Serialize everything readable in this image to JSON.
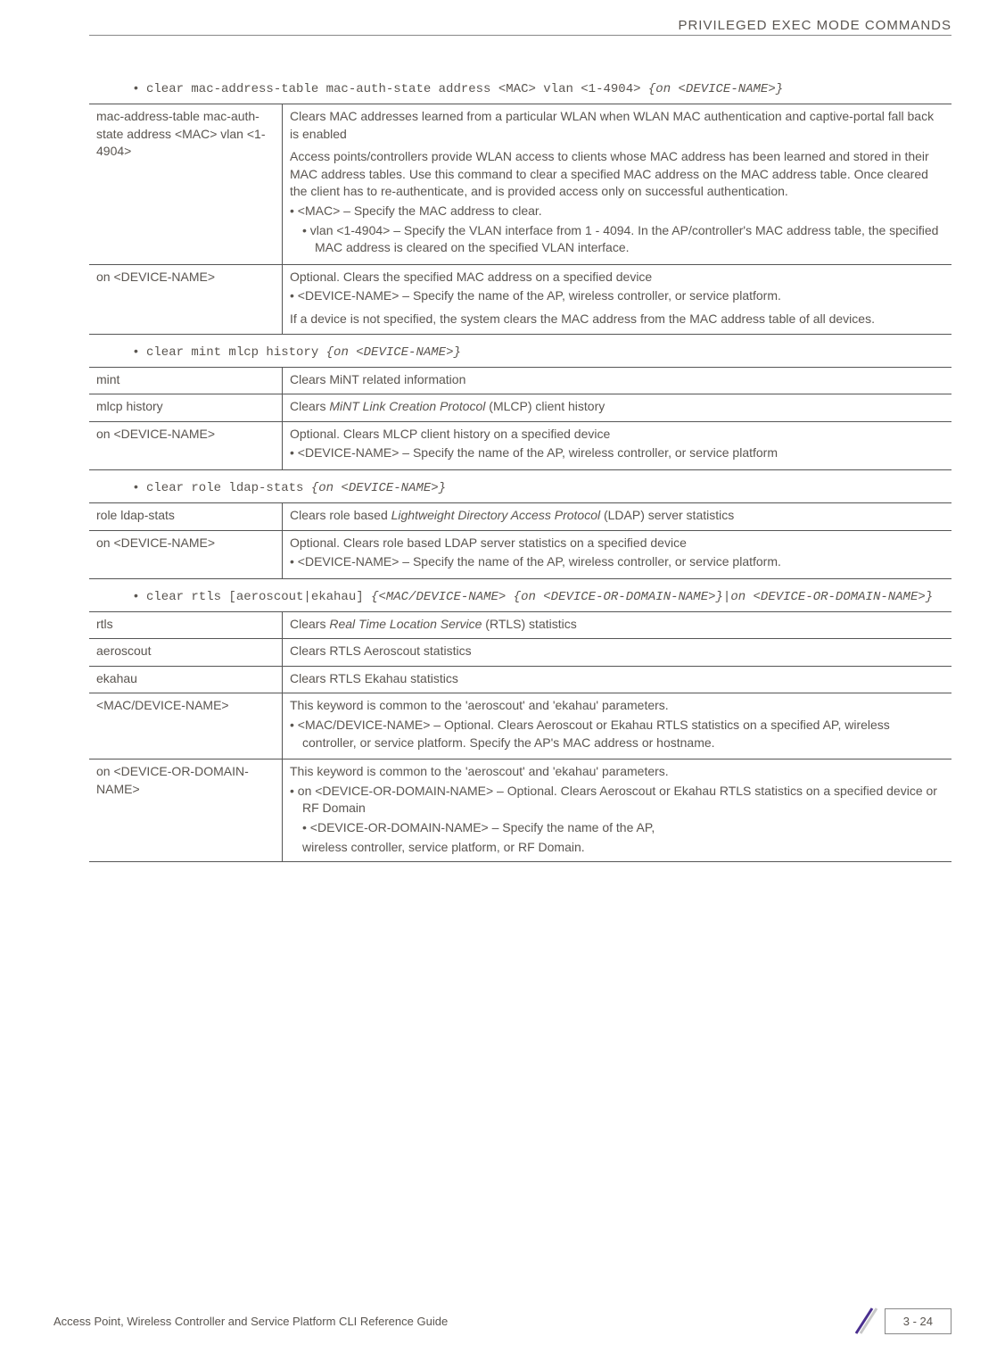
{
  "header": {
    "title": "PRIVILEGED EXEC MODE COMMANDS"
  },
  "syntax1": {
    "cmd": "clear mac-address-table mac-auth-state address <MAC> vlan <1-4904> ",
    "opt": "{on <DEVICE-NAME>}"
  },
  "table1": {
    "r1c1": "mac-address-table mac-auth-state address <MAC> vlan <1-4904>",
    "r1p1": "Clears MAC addresses learned from a particular WLAN when WLAN MAC authentication and captive-portal fall back is enabled",
    "r1p2": "Access points/controllers provide WLAN access to clients whose MAC address has been learned and stored in their MAC address tables. Use this command to clear a specified MAC address on the MAC address table. Once cleared the client has to re-authenticate, and is provided access only on successful authentication.",
    "r1b1": "<MAC> – Specify the MAC address to clear.",
    "r1b2": "vlan <1-4904> – Specify the VLAN interface from 1 - 4094. In the AP/controller's MAC address table, the specified MAC address is cleared on the specified VLAN interface.",
    "r2c1": "on <DEVICE-NAME>",
    "r2p1": "Optional. Clears the specified MAC address on a specified device",
    "r2b1": "<DEVICE-NAME> – Specify the name of the AP, wireless controller, or service platform.",
    "r2p2": "If a device is not specified, the system clears the MAC address from the MAC address table of all devices."
  },
  "syntax2": {
    "cmd": "clear mint mlcp history ",
    "opt": "{on <DEVICE-NAME>}"
  },
  "table2": {
    "r1c1": "mint",
    "r1c2": "Clears MiNT related information",
    "r2c1": "mlcp history",
    "r2c2a": "Clears ",
    "r2c2i": "MiNT Link Creation Protocol",
    "r2c2b": " (MLCP) client history",
    "r3c1": "on <DEVICE-NAME>",
    "r3p1": "Optional. Clears MLCP client history on a specified device",
    "r3b1": "<DEVICE-NAME> – Specify the name of the AP, wireless controller, or service platform"
  },
  "syntax3": {
    "cmd": "clear role ldap-stats ",
    "opt": "{on <DEVICE-NAME>}"
  },
  "table3": {
    "r1c1": "role ldap-stats",
    "r1c2a": "Clears role based ",
    "r1c2i": "Lightweight Directory Access Protocol",
    "r1c2b": " (LDAP) server statistics",
    "r2c1": "on <DEVICE-NAME>",
    "r2p1": "Optional. Clears role based LDAP server statistics on a specified device",
    "r2b1": "<DEVICE-NAME> – Specify the name of the AP, wireless controller, or service platform."
  },
  "syntax4": {
    "cmd": "clear rtls [aeroscout|ekahau] ",
    "opt": "{<MAC/DEVICE-NAME> {on <DEVICE-OR-DOMAIN-NAME>}|on <DEVICE-OR-DOMAIN-NAME>}"
  },
  "table4": {
    "r1c1": "rtls",
    "r1c2a": "Clears ",
    "r1c2i": "Real Time Location Service",
    "r1c2b": " (RTLS) statistics",
    "r2c1": "aeroscout",
    "r2c2": "Clears RTLS Aeroscout statistics",
    "r3c1": "ekahau",
    "r3c2": "Clears RTLS Ekahau statistics",
    "r4c1": "<MAC/DEVICE-NAME>",
    "r4p1": "This keyword is common to the 'aeroscout' and 'ekahau' parameters.",
    "r4b1": "<MAC/DEVICE-NAME> – Optional. Clears Aeroscout or Ekahau RTLS statistics on a specified AP, wireless controller, or service platform. Specify the AP's MAC address or hostname.",
    "r5c1": "on <DEVICE-OR-DOMAIN-NAME>",
    "r5p1": "This keyword is common to the 'aeroscout' and 'ekahau' parameters.",
    "r5b1": "on <DEVICE-OR-DOMAIN-NAME> – Optional. Clears Aeroscout or Ekahau RTLS statistics on a specified device or RF Domain",
    "r5b2": "<DEVICE-OR-DOMAIN-NAME> – Specify the name of the AP,",
    "r5p2": "wireless controller, service platform, or RF Domain."
  },
  "footer": {
    "text": "Access Point, Wireless Controller and Service Platform CLI Reference Guide",
    "page": "3 - 24"
  }
}
